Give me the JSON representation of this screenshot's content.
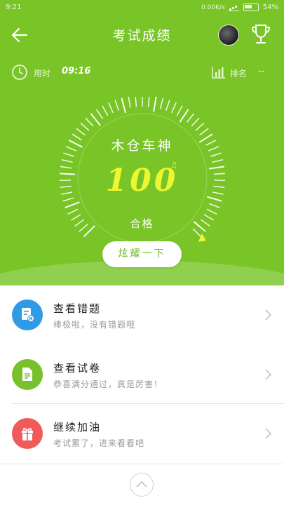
{
  "status_bar": {
    "time": "9:21",
    "net_speed": "0.00K/s",
    "battery": "54%"
  },
  "header": {
    "title": "考试成绩",
    "back_icon": "arrow-left-icon",
    "trophy_icon": "trophy-icon"
  },
  "info": {
    "time_label": "用时",
    "time_value": "09:16",
    "rank_label": "排名",
    "rank_value": "--"
  },
  "result": {
    "user_name": "木仓车神",
    "score": "100",
    "result_text": "合格",
    "share_button": "炫耀一下",
    "score_fraction": 1.0
  },
  "menu": [
    {
      "title": "查看错题",
      "subtitle": "棒极啦，没有错题哦",
      "icon": "wrong-answers-icon",
      "color": "#2f9be7"
    },
    {
      "title": "查看试卷",
      "subtitle": "恭喜满分通过，真是厉害！",
      "icon": "exam-paper-icon",
      "color": "#78c12a"
    },
    {
      "title": "继续加油",
      "subtitle": "考试累了，进来看看吧",
      "icon": "gift-icon",
      "color": "#f15a5a"
    }
  ],
  "colors": {
    "hero_green": "#79c528",
    "score_yellow": "#ecf72f"
  }
}
